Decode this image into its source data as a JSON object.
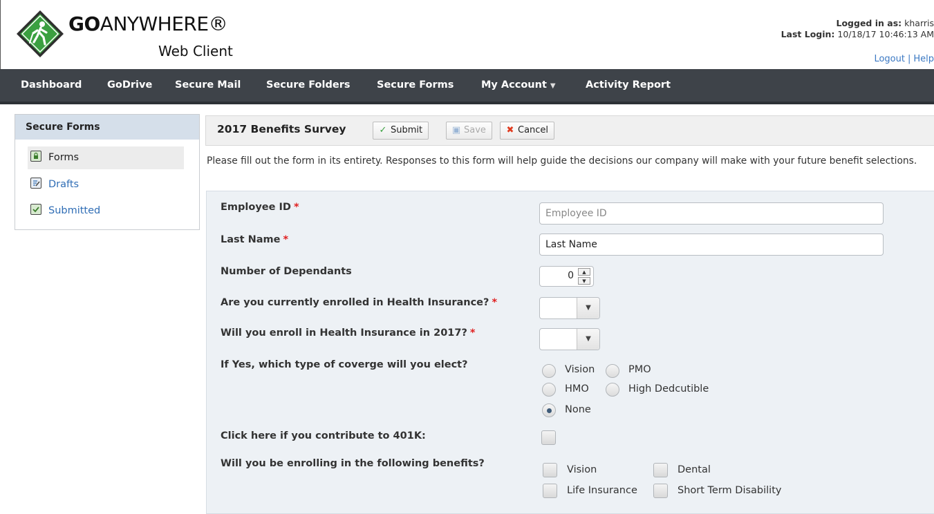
{
  "header": {
    "brand_bold": "GO",
    "brand_rest": "ANYWHERE®",
    "brand_sub": "Web Client",
    "logged_in_label": "Logged in as:",
    "logged_in_user": "kharris",
    "last_login_label": "Last Login:",
    "last_login_value": "10/18/17 10:46:13 AM",
    "logout": "Logout",
    "separator": "|",
    "help": "Help"
  },
  "nav": {
    "items": [
      "Dashboard",
      "GoDrive",
      "Secure Mail",
      "Secure Folders",
      "Secure Forms",
      "My Account",
      "Activity Report"
    ],
    "my_account_caret": "▼"
  },
  "sidebar": {
    "title": "Secure Forms",
    "items": [
      {
        "label": "Forms",
        "icon": "lock-icon",
        "active": true
      },
      {
        "label": "Drafts",
        "icon": "draft-icon",
        "active": false
      },
      {
        "label": "Submitted",
        "icon": "check-icon",
        "active": false
      }
    ]
  },
  "toolbar": {
    "form_title": "2017 Benefits Survey",
    "submit_label": "Submit",
    "save_label": "Save",
    "cancel_label": "Cancel"
  },
  "intro_text": "Please fill out the form in its entirety. Responses to this form will help guide the decisions our company will make with your future benefit selections.",
  "form": {
    "employee_id": {
      "label": "Employee ID",
      "required": "*",
      "placeholder": "Employee ID",
      "value": ""
    },
    "last_name": {
      "label": "Last Name",
      "required": "*",
      "value": "Last Name"
    },
    "dependants": {
      "label": "Number of Dependants",
      "value": "0"
    },
    "enrolled_health": {
      "label": "Are you currently enrolled in Health Insurance?",
      "required": "*",
      "value": ""
    },
    "enroll_2017": {
      "label": "Will you enroll in Health Insurance in 2017?",
      "required": "*",
      "value": ""
    },
    "coverage": {
      "label": "If Yes, which type of coverge will you elect?",
      "options": [
        "Vision",
        "PMO",
        "HMO",
        "High Dedcutible",
        "None"
      ],
      "selected": "None"
    },
    "contribute_401k": {
      "label": "Click here if you contribute to 401K:",
      "checked": false
    },
    "benefits": {
      "label": "Will you be enrolling in the following benefits?",
      "options": [
        "Vision",
        "Dental",
        "Life Insurance",
        "Short Term Disability"
      ]
    }
  },
  "colors": {
    "nav_bg": "#3e4349",
    "link": "#3a78c3",
    "required": "#e02020",
    "logo_green": "#3aa040",
    "panel_bg": "#edf1f5"
  }
}
